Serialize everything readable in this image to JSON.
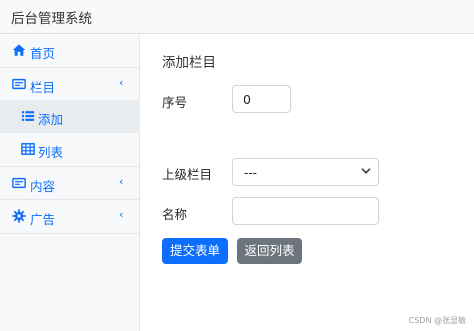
{
  "header": {
    "title": "后台管理系统"
  },
  "sidebar": {
    "items": [
      {
        "label": "首页",
        "icon": "home-icon"
      },
      {
        "label": "栏目",
        "icon": "card-icon",
        "chevron": "‹"
      },
      {
        "label": "添加",
        "icon": "list-icon",
        "active": true
      },
      {
        "label": "列表",
        "icon": "table-icon"
      },
      {
        "label": "内容",
        "icon": "card-icon",
        "chevron": "‹"
      },
      {
        "label": "广告",
        "icon": "gear-icon",
        "chevron": "‹"
      }
    ]
  },
  "main": {
    "title": "添加栏目",
    "form": {
      "order_label": "序号",
      "order_value": "0",
      "parent_label": "上级栏目",
      "parent_selected": "---",
      "name_label": "名称",
      "name_value": ""
    },
    "buttons": {
      "submit_label": "提交表单",
      "back_label": "返回列表"
    }
  },
  "watermark": "CSDN @张显敏",
  "colors": {
    "primary": "#0d6efd",
    "secondary": "#6c757d",
    "sidebar_bg": "#f8f9fa",
    "active_bg": "#e9ecef"
  }
}
